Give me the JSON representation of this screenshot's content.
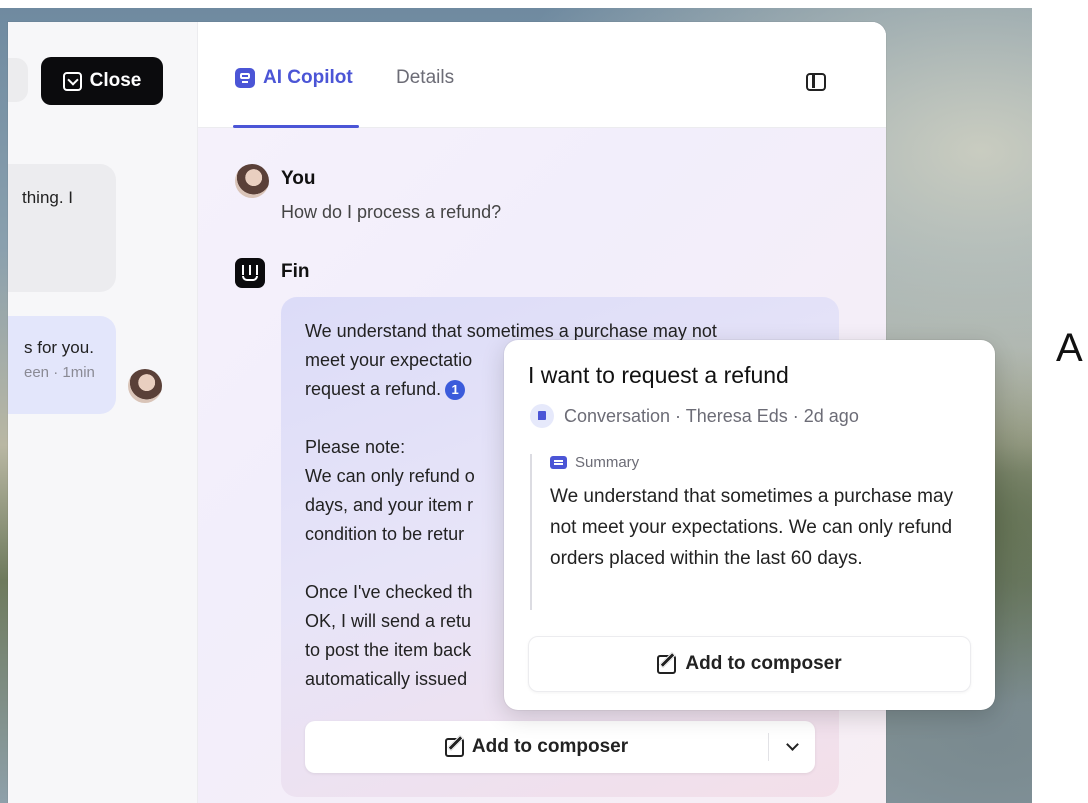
{
  "left_pane": {
    "close_label": "Close",
    "bubble_gray_text": "thing. I",
    "bubble_blue_text": "s for you.",
    "bubble_blue_meta": "een · 1min"
  },
  "tabs": [
    {
      "label": "AI Copilot",
      "active": true
    },
    {
      "label": "Details",
      "active": false
    }
  ],
  "copilot": {
    "you_name": "You",
    "you_question": "How do I process a refund?",
    "fin_name": "Fin",
    "answer_lines": {
      "l1": "We understand that sometimes a purchase may not",
      "l2": "meet your expectatio",
      "l3": "request a refund.",
      "citation": "1",
      "l4": "Please note:",
      "l5": "We can only refund o",
      "l6": "days, and your item r",
      "l7": "condition to be retur",
      "l8": "Once I've checked th",
      "l9": "OK, I will send a retu",
      "l10": "to post the item back",
      "l11": "automatically issued"
    },
    "add_to_composer": "Add to composer"
  },
  "popover": {
    "title": "I want to request a refund",
    "meta": "Conversation · Theresa Eds · 2d ago",
    "summary_tag": "Summary",
    "summary_text": "We understand that sometimes a purchase may not meet your expectations. We can only refund orders placed within the last 60 days.",
    "add_to_composer": "Add to composer"
  },
  "side_letter": "A",
  "colors": {
    "accent": "#4b55d6",
    "close_button_bg": "#0b0b0d",
    "citation_badge": "#3b5bdb"
  }
}
